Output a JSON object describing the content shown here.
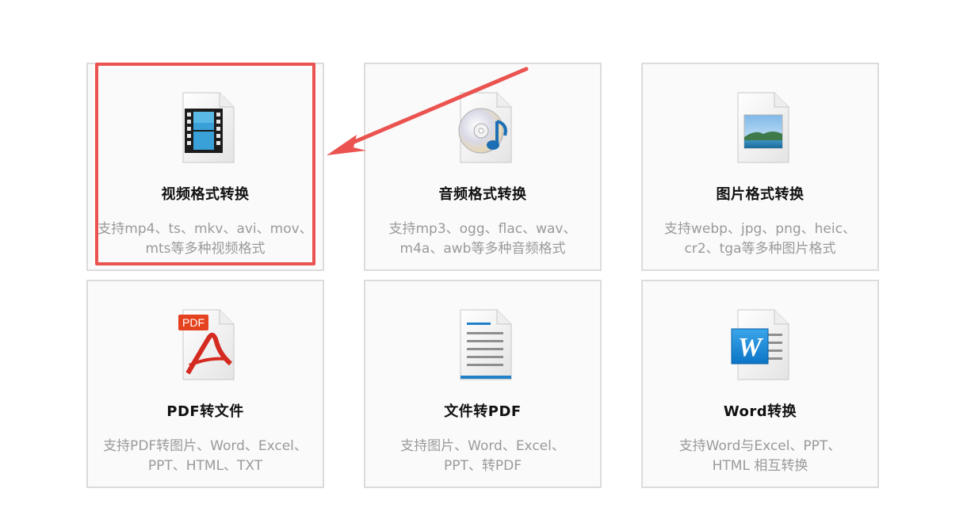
{
  "cards": [
    {
      "title": "视频格式转换",
      "desc": "支持mp4、ts、mkv、avi、mov、\nmts等多种视频格式",
      "icon": "video-file-icon"
    },
    {
      "title": "音频格式转换",
      "desc": "支持mp3、ogg、flac、wav、\nm4a、awb等多种音频格式",
      "icon": "audio-file-icon"
    },
    {
      "title": "图片格式转换",
      "desc": "支持webp、jpg、png、heic、\ncr2、tga等多种图片格式",
      "icon": "image-file-icon"
    },
    {
      "title": "PDF转文件",
      "desc": "支持PDF转图片、Word、Excel、\nPPT、HTML、TXT",
      "icon": "pdf-file-icon",
      "icon_label": "PDF"
    },
    {
      "title": "文件转PDF",
      "desc": "支持图片、Word、Excel、\nPPT、转PDF",
      "icon": "text-document-icon"
    },
    {
      "title": "Word转换",
      "desc": "支持Word与Excel、PPT、\nHTML 相互转换",
      "icon": "word-file-icon",
      "icon_label": "W"
    }
  ],
  "colors": {
    "annotation": "#ea5350",
    "card_border": "#dcdcdc",
    "card_bg": "#fafafa",
    "title": "#111111",
    "desc": "#9a9a9a"
  }
}
